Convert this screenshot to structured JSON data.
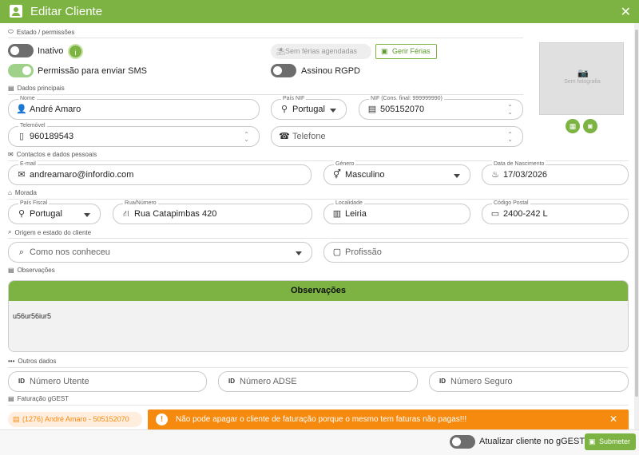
{
  "window": {
    "title": "Editar Cliente"
  },
  "sections": {
    "estado": "Estado / permissões",
    "principais": "Dados principais",
    "contactos": "Contactos e dados pessoais",
    "morada": "Morada",
    "origem": "Origem e estado do cliente",
    "observacoes": "Observações",
    "outros": "Outros dados",
    "faturacao": "Faturação gGEST"
  },
  "estado": {
    "inativo_label": "Inativo",
    "sms_label": "Permissão para enviar SMS",
    "rgpd_label": "Assinou RGPD",
    "ferias_badge": "Sem férias agendadas",
    "gerir_ferias": "Gerir Férias",
    "inativo_on": false,
    "sms_on": true,
    "rgpd_on": false
  },
  "photo": {
    "placeholder": "Sem fotografia"
  },
  "fields": {
    "nome": {
      "label": "Nome",
      "value": "André Amaro"
    },
    "pais_nif": {
      "label": "País NIF",
      "value": "Portugal"
    },
    "nif": {
      "label": "NIF (Cons. final: 999999990)",
      "value": "505152070"
    },
    "telemovel": {
      "label": "Telemóvel",
      "value": "960189543"
    },
    "telefone": {
      "placeholder": "Telefone"
    },
    "email": {
      "label": "E-mail",
      "value": "andreamaro@infordio.com"
    },
    "genero": {
      "label": "Género",
      "value": "Masculino"
    },
    "nascimento": {
      "label": "Data de Nascimento",
      "value": "17/03/2026"
    },
    "pais_fiscal": {
      "label": "País Fiscal",
      "value": "Portugal"
    },
    "rua": {
      "label": "Rua/Número",
      "value": "Rua Catapimbas 420"
    },
    "localidade": {
      "label": "Localidade",
      "value": "Leiria"
    },
    "codigo_postal": {
      "label": "Código Postal",
      "value": "2400-242 L"
    },
    "como_conheceu": {
      "placeholder": "Como nos conheceu"
    },
    "profissao": {
      "placeholder": "Profissão"
    },
    "numero_utente": {
      "placeholder": "Número Utente"
    },
    "numero_adse": {
      "placeholder": "Número ADSE"
    },
    "numero_seguro": {
      "placeholder": "Número Seguro"
    }
  },
  "observacoes": {
    "header": "Observações",
    "text": "u56ur56iur5"
  },
  "faturacao": {
    "client_chip": "(1276) André Amaro - 505152070",
    "alert": "Não pode apagar o cliente de faturação porque o mesmo tem faturas não pagas!!!"
  },
  "footer": {
    "atualizar_label": "Atualizar cliente no gGEST",
    "atualizar_on": false,
    "submit": "Submeter"
  },
  "colors": {
    "accent": "#7cb342",
    "warning": "#f68a0f"
  },
  "icons": {
    "title": "contact-card-icon",
    "close": "close-icon",
    "info": "info-icon",
    "camera": "camera-icon",
    "gallery": "image-icon",
    "calendar": "calendar-icon",
    "person": "person-icon",
    "pin": "location-pin-icon",
    "id": "id-card-icon",
    "phone": "mobile-phone-icon",
    "landline": "telephone-icon",
    "mail": "email-icon",
    "gender": "gender-icon",
    "cake": "cake-icon",
    "road": "road-icon",
    "building": "building-icon",
    "mailbox": "mailbox-icon",
    "search": "search-icon",
    "briefcase": "briefcase-icon",
    "save": "save-icon",
    "warning": "warning-icon"
  }
}
